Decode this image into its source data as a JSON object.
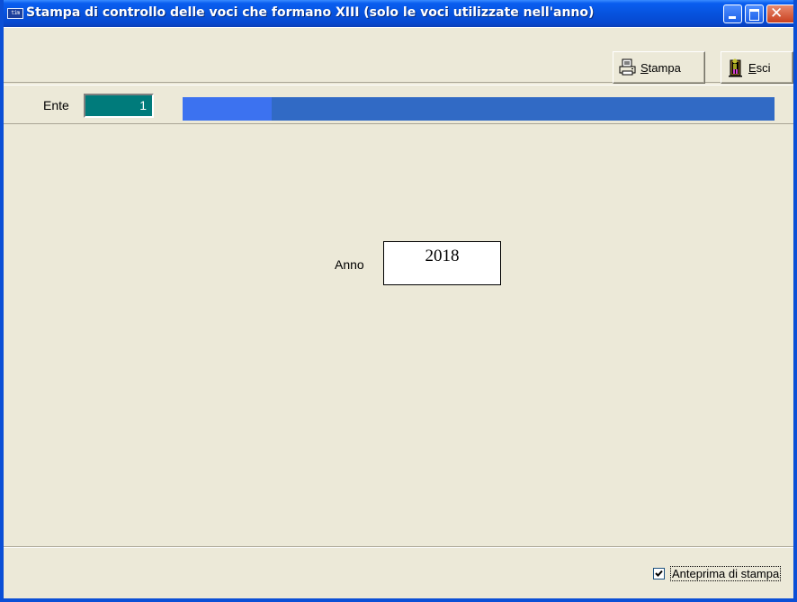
{
  "window": {
    "app_icon_text": "tim",
    "title": "Stampa di controllo delle voci che formano XIII (solo le voci utilizzate nell'anno)"
  },
  "toolbar": {
    "stampa_label_first": "S",
    "stampa_label_rest": "tampa",
    "esci_label_first": "E",
    "esci_label_rest": "sci"
  },
  "ente": {
    "label": "Ente",
    "value": "1"
  },
  "progress": {
    "fraction": 0.15
  },
  "anno": {
    "label": "Anno",
    "value": "2018"
  },
  "options": {
    "anteprima_label": "Anteprima di stampa",
    "anteprima_checked": true
  },
  "colors": {
    "titlebar": "#0653de",
    "ente_field_bg": "#007b7b",
    "progress_bar": "#316ac5",
    "progress_fill": "#3c72f0",
    "window_bg": "#ece9d8"
  }
}
